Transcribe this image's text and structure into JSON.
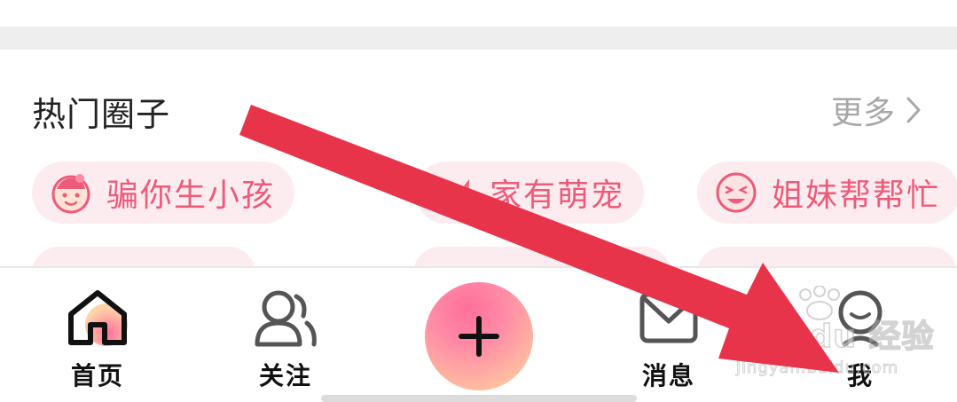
{
  "section": {
    "title": "热门圈子",
    "more_label": "更多"
  },
  "circles": [
    {
      "label": "骗你生小孩",
      "icon": "baby-face-icon"
    },
    {
      "label": "家有萌宠",
      "icon": "pet-icon"
    },
    {
      "label": "姐妹帮帮忙",
      "icon": "crying-face-icon"
    }
  ],
  "tabbar": {
    "home_label": "首页",
    "follow_label": "关注",
    "post_icon": "plus-icon",
    "messages_label": "消息",
    "me_label": "我"
  },
  "watermark": {
    "brand": "Bai du 经验",
    "url": "jingyan.baidu.com"
  },
  "colors": {
    "accent": "#ee5a7a",
    "chip_bg": "#fdecef",
    "arrow": "#e8344a",
    "divider": "#eeeeee"
  }
}
